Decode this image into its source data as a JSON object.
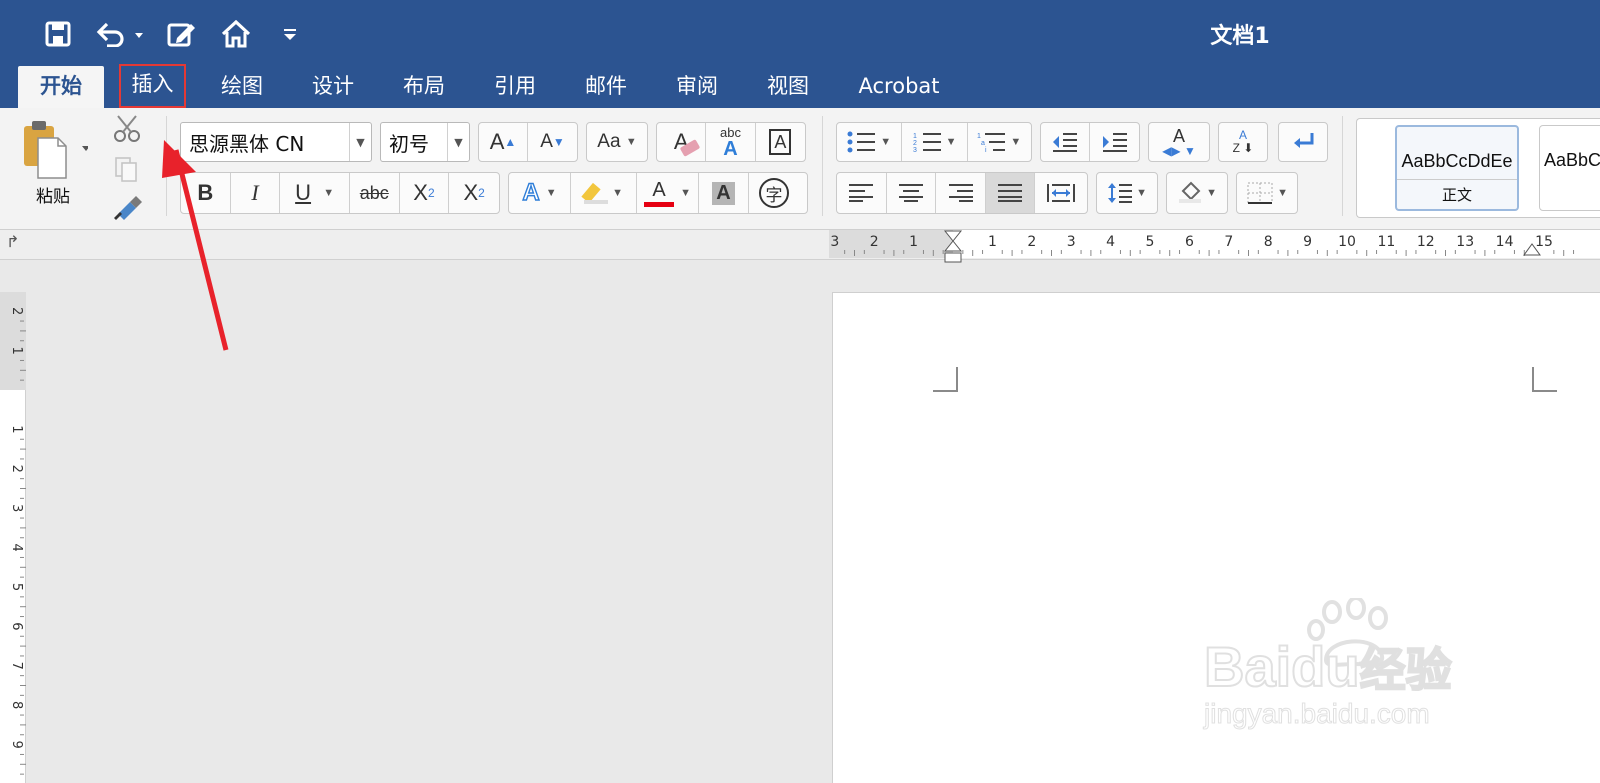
{
  "app": {
    "doc_title": "文档1"
  },
  "quick_access": {
    "items": [
      "save-icon",
      "undo-icon",
      "edit-icon",
      "home-icon",
      "customize-icon"
    ]
  },
  "tabs": [
    {
      "label": "开始",
      "active": true
    },
    {
      "label": "插入",
      "highlighted": true
    },
    {
      "label": "绘图"
    },
    {
      "label": "设计"
    },
    {
      "label": "布局"
    },
    {
      "label": "引用"
    },
    {
      "label": "邮件"
    },
    {
      "label": "审阅"
    },
    {
      "label": "视图"
    },
    {
      "label": "Acrobat"
    }
  ],
  "ribbon": {
    "paste_label": "粘贴",
    "font_name": "思源黑体 CN",
    "font_size": "初号",
    "styles": [
      {
        "preview": "AaBbCcDdEe",
        "name": "正文",
        "selected": true
      },
      {
        "preview": "AaBbCcDdEe",
        "name": ""
      }
    ],
    "format_buttons": {
      "bold": "B",
      "italic": "I",
      "underline": "U",
      "strike": "abc",
      "sub": "X",
      "sup": "X"
    },
    "grow_font": "A",
    "shrink_font": "A",
    "case": "Aa",
    "clear": "A",
    "phonetic_top": "abc",
    "phonetic": "A",
    "border_char": "A",
    "effects": "A",
    "font_color": "A",
    "shading": "A",
    "enclose": "字"
  },
  "ruler": {
    "h_ticks": [
      "3",
      "2",
      "1",
      "1",
      "2",
      "3",
      "4",
      "5",
      "6",
      "7",
      "8",
      "9",
      "10",
      "11",
      "12",
      "13",
      "14",
      "15"
    ],
    "v_ticks": [
      "2",
      "1",
      "1",
      "2",
      "3",
      "4",
      "5",
      "6",
      "7",
      "8",
      "9"
    ]
  },
  "colors": {
    "title_bar": "#2c5491",
    "ribbon": "#f3f3f3",
    "highlight_box": "#e53935",
    "arrow": "#e8222b",
    "font_color_bar": "#e60012"
  },
  "watermark": {
    "brand_left": "Bai",
    "brand_mid": "du",
    "brand_cn": "经验",
    "url": "jingyan.baidu.com"
  }
}
